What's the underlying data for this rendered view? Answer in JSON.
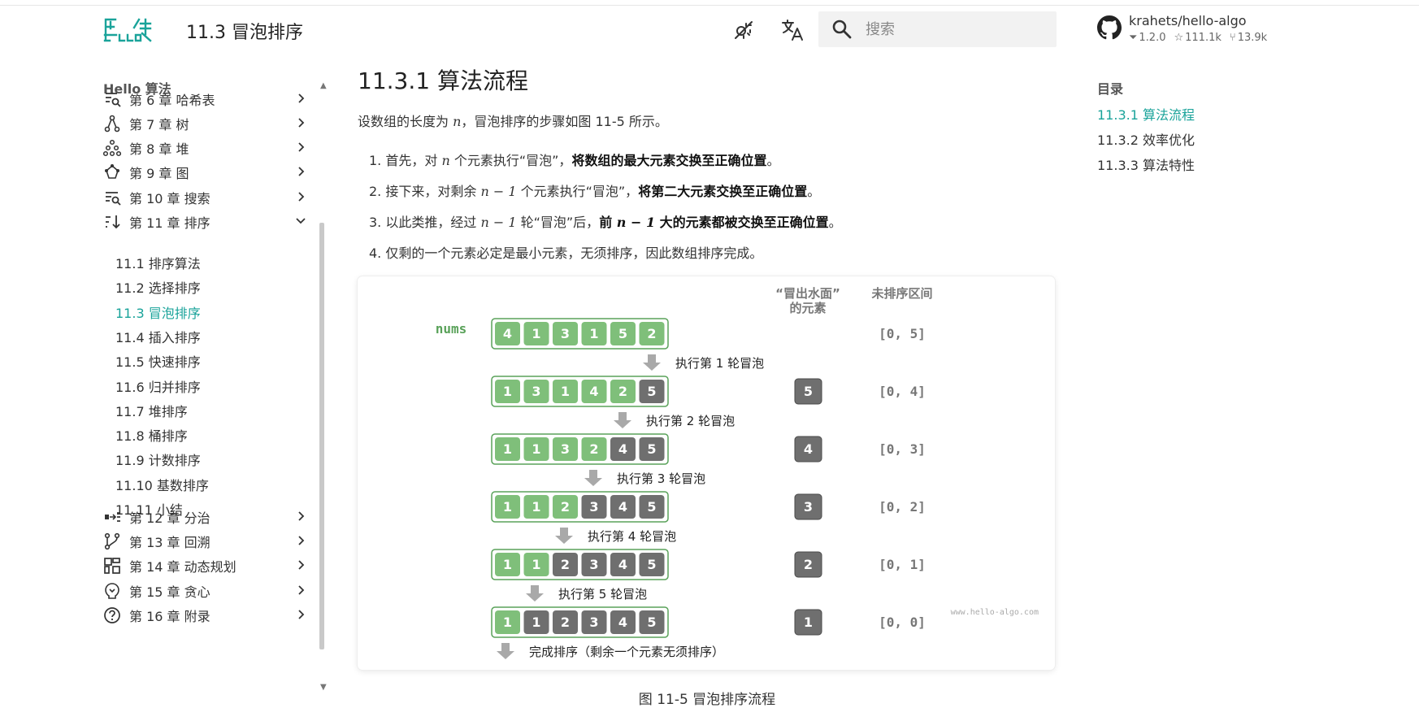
{
  "colors": {
    "accent": "#1aa39a",
    "green_cell": "#7fbf7a",
    "green_border": "#5aa25a",
    "gray_cell": "#6f6f6f",
    "arrow": "#a9a9a9"
  },
  "header": {
    "title": "11.3   冒泡排序",
    "icons": [
      "theme-toggle-icon",
      "translate-icon"
    ],
    "search_placeholder": "搜索"
  },
  "repo": {
    "name": "krahets/hello-algo",
    "version": "1.2.0",
    "stars": "111.1k",
    "forks": "13.9k"
  },
  "sidebar": {
    "title": "Hello 算法",
    "items": [
      {
        "label": "第 6 章   哈希表",
        "icon": "hash-table-icon",
        "expanded": false
      },
      {
        "label": "第 7 章   树",
        "icon": "tree-icon",
        "expanded": false
      },
      {
        "label": "第 8 章   堆",
        "icon": "heap-icon",
        "expanded": false
      },
      {
        "label": "第 9 章   图",
        "icon": "graph-icon",
        "expanded": false
      },
      {
        "label": "第 10 章   搜索",
        "icon": "search-list-icon",
        "expanded": false
      },
      {
        "label": "第 11 章   排序",
        "icon": "sort-icon",
        "expanded": true
      },
      {
        "label": "第 12 章   分治",
        "icon": "divide-icon",
        "expanded": false
      },
      {
        "label": "第 13 章   回溯",
        "icon": "backtrack-icon",
        "expanded": false
      },
      {
        "label": "第 14 章   动态规划",
        "icon": "dp-icon",
        "expanded": false
      },
      {
        "label": "第 15 章   贪心",
        "icon": "greedy-icon",
        "expanded": false
      },
      {
        "label": "第 16 章   附录",
        "icon": "help-icon",
        "expanded": false
      }
    ],
    "subitems": [
      {
        "label": "11.1   排序算法",
        "active": false
      },
      {
        "label": "11.2   选择排序",
        "active": false
      },
      {
        "label": "11.3   冒泡排序",
        "active": true
      },
      {
        "label": "11.4   插入排序",
        "active": false
      },
      {
        "label": "11.5   快速排序",
        "active": false
      },
      {
        "label": "11.6   归并排序",
        "active": false
      },
      {
        "label": "11.7   堆排序",
        "active": false
      },
      {
        "label": "11.8   桶排序",
        "active": false
      },
      {
        "label": "11.9   计数排序",
        "active": false
      },
      {
        "label": "11.10   基数排序",
        "active": false
      },
      {
        "label": "11.11   小结",
        "active": false
      }
    ]
  },
  "content": {
    "heading": "11.3.1   算法流程",
    "intro": {
      "pre": "设数组的长度为 ",
      "var": "n",
      "post": "，冒泡排序的步骤如图 11-5 所示。"
    },
    "steps": [
      {
        "parts": [
          {
            "t": "1. 首先，对 "
          },
          {
            "v": "n"
          },
          {
            "t": " 个元素执行“冒泡”，"
          },
          {
            "b": "将数组的最大元素交换至正确位置"
          },
          {
            "t": "。"
          }
        ]
      },
      {
        "parts": [
          {
            "t": "2. 接下来，对剩余 "
          },
          {
            "v": "n − 1"
          },
          {
            "t": " 个元素执行“冒泡”，"
          },
          {
            "b": "将第二大元素交换至正确位置"
          },
          {
            "t": "。"
          }
        ]
      },
      {
        "parts": [
          {
            "t": "3. 以此类推，经过 "
          },
          {
            "v": "n − 1"
          },
          {
            "t": " 轮“冒泡”后，"
          },
          {
            "b": "前 "
          },
          {
            "bv": "n − 1"
          },
          {
            "b": " 大的元素都被交换至正确位置"
          },
          {
            "t": "。"
          }
        ]
      },
      {
        "parts": [
          {
            "t": "4. 仅剩的一个元素必定是最小元素，无须排序，因此数组排序完成。"
          }
        ]
      }
    ],
    "figure": {
      "header_bubbled": [
        "“冒出水面”",
        "的元素"
      ],
      "header_unsorted": "未排序区间",
      "nums_label": "nums",
      "rows": [
        {
          "cells": [
            4,
            1,
            3,
            1,
            5,
            2
          ],
          "sorted_from": 6,
          "highlight": -1,
          "bubbled": "",
          "interval": "[0, 5]"
        },
        {
          "cells": [
            1,
            3,
            1,
            4,
            2,
            5
          ],
          "sorted_from": 5,
          "highlight": -1,
          "bubbled": "5",
          "interval": "[0, 4]"
        },
        {
          "cells": [
            1,
            1,
            3,
            2,
            4,
            5
          ],
          "sorted_from": 4,
          "highlight": -1,
          "bubbled": "4",
          "interval": "[0, 3]"
        },
        {
          "cells": [
            1,
            1,
            2,
            3,
            4,
            5
          ],
          "sorted_from": 3,
          "highlight": -1,
          "bubbled": "3",
          "interval": "[0, 2]"
        },
        {
          "cells": [
            1,
            1,
            2,
            3,
            4,
            5
          ],
          "sorted_from": 2,
          "highlight": -1,
          "bubbled": "2",
          "interval": "[0, 1]"
        },
        {
          "cells": [
            1,
            1,
            2,
            3,
            4,
            5
          ],
          "sorted_from": 1,
          "highlight": -1,
          "bubbled": "1",
          "interval": "[0, 0]"
        }
      ],
      "round_labels": [
        "执行第  1  轮冒泡",
        "执行第  2  轮冒泡",
        "执行第  3  轮冒泡",
        "执行第  4  轮冒泡",
        "执行第  5  轮冒泡",
        "完成排序（剩余一个元素无须排序）"
      ],
      "watermark": "www.hello-algo.com"
    },
    "caption": "图 11-5   冒泡排序流程"
  },
  "toc": {
    "title": "目录",
    "items": [
      {
        "label": "11.3.1   算法流程",
        "active": true
      },
      {
        "label": "11.3.2   效率优化",
        "active": false
      },
      {
        "label": "11.3.3   算法特性",
        "active": false
      }
    ]
  }
}
